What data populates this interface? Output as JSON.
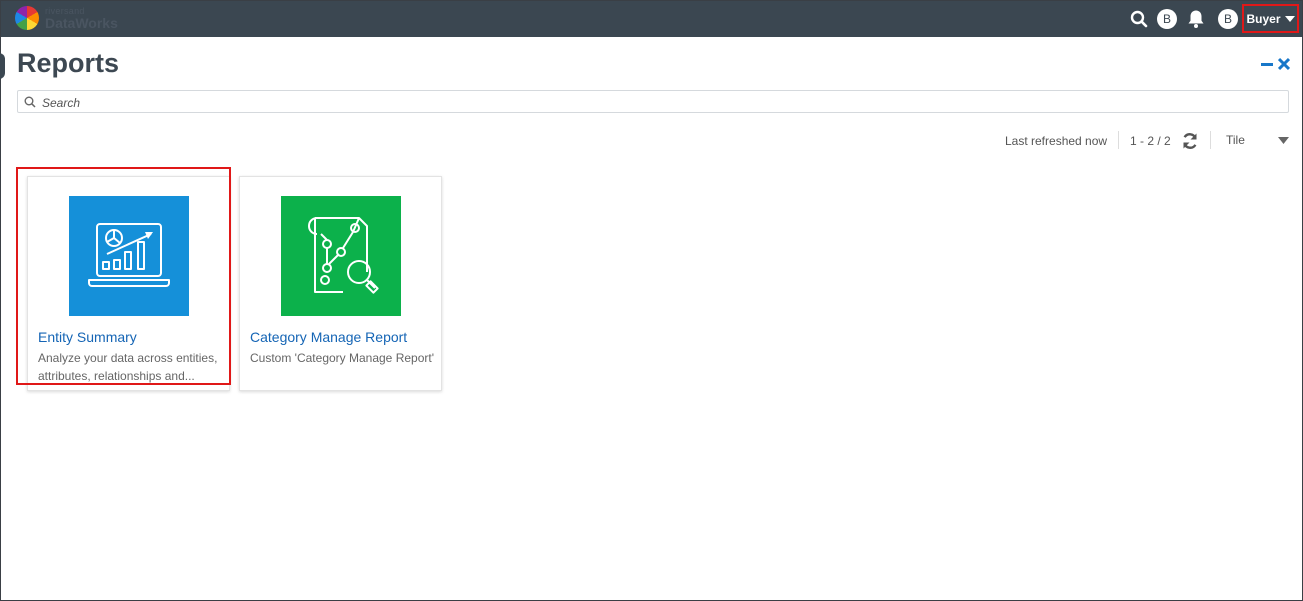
{
  "app": {
    "logo_small": "riversand",
    "logo_big": "DataWorks"
  },
  "header": {
    "avatar_1": "B",
    "avatar_2": "B",
    "role": "Buyer"
  },
  "page": {
    "title": "Reports",
    "minimize_label": "–",
    "close_label": "✕"
  },
  "search": {
    "placeholder": "Search"
  },
  "toolbar": {
    "last_refreshed": "Last refreshed now",
    "pagination": "1 - 2 / 2",
    "view_mode": "Tile"
  },
  "cards": [
    {
      "title": "Entity Summary",
      "description": "Analyze your data across entities, attributes, relationships and...",
      "color": "#1590d9",
      "icon": "analytics-laptop-icon"
    },
    {
      "title": "Category Manage Report",
      "description": "Custom 'Category Manage Report'",
      "color": "#0cb14b",
      "icon": "report-search-icon"
    }
  ],
  "colors": {
    "topbar": "#3b4751",
    "accent": "#1877c9",
    "highlight": "#e01818"
  }
}
